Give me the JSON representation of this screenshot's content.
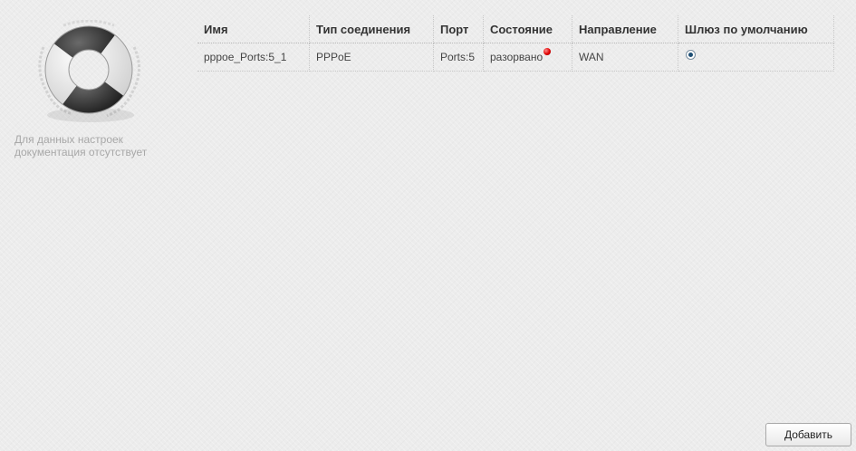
{
  "help": {
    "icon": "lifebuoy-icon",
    "text_line1": "Для данных настроек",
    "text_line2": "документация отсутствует"
  },
  "table": {
    "headers": [
      "Имя",
      "Тип соединения",
      "Порт",
      "Состояние",
      "Направление",
      "Шлюз по умолчанию"
    ],
    "rows": [
      {
        "name": "pppoe_Ports:5_1",
        "type": "PPPoE",
        "port": "Ports:5",
        "state": "разорвано",
        "state_color": "#e00000",
        "direction": "WAN",
        "default_gateway": true
      }
    ]
  },
  "actions": {
    "add_label": "Добавить"
  }
}
